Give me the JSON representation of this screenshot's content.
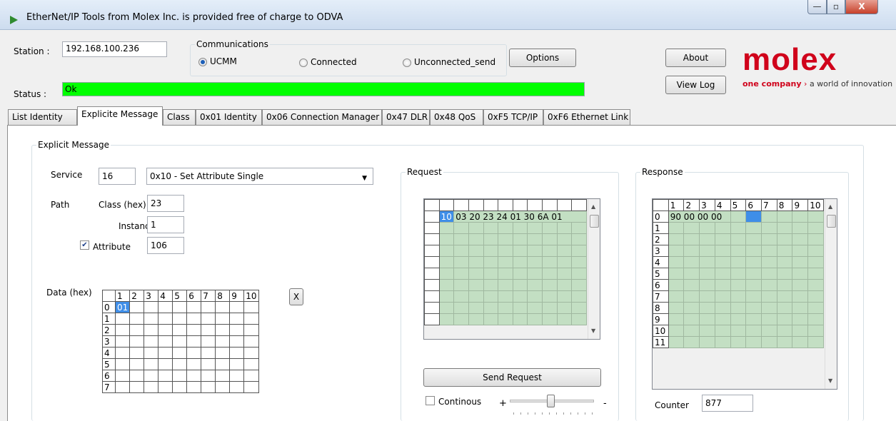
{
  "window": {
    "title": "EtherNet/IP Tools from Molex Inc. is provided free of charge to ODVA"
  },
  "caption_buttons": {
    "minimize": "—",
    "maximize": "▫",
    "close": "X"
  },
  "station": {
    "label": "Station :",
    "value": "192.168.100.236"
  },
  "communications": {
    "legend": "Communications",
    "options": [
      "UCMM",
      "Connected",
      "Unconnected_send"
    ],
    "selected": "UCMM"
  },
  "buttons": {
    "options": "Options",
    "about": "About",
    "view_log": "View Log",
    "send_request": "Send Request",
    "clear": "X"
  },
  "status": {
    "label": "Status :",
    "value": "Ok",
    "color": "#00ff00"
  },
  "logo": {
    "text": "molex",
    "tagline_bold": "one company",
    "tagline_rest": "a world of innovation",
    "color": "#d0021b"
  },
  "tabs": [
    "List Identity",
    "Explicite Message",
    "Class",
    "0x01 Identity",
    "0x06 Connection Manager",
    "0x47 DLR",
    "0x48 QoS",
    "0xF5 TCP/IP",
    "0xF6 Ethernet Link"
  ],
  "active_tab": "Explicite Message",
  "explicit": {
    "legend": "Explicit Message",
    "service_label": "Service",
    "service_code": "16",
    "service_selected": "0x10 - Set Attribute Single",
    "path_label": "Path",
    "class_label": "Class (hex)",
    "class_value": "23",
    "instance_label": "Instance",
    "instance_value": "1",
    "attribute_label": "Attribute",
    "attribute_checked": true,
    "attribute_value": "106",
    "data_label": "Data (hex)",
    "data_columns": [
      "1",
      "2",
      "3",
      "4",
      "5",
      "6",
      "7",
      "8",
      "9",
      "10"
    ],
    "data_rows": [
      "0",
      "1",
      "2",
      "3",
      "4",
      "5",
      "6",
      "7"
    ],
    "data_first_cell": "01"
  },
  "request": {
    "legend": "Request",
    "first_cell": "10",
    "row_text": "03 20 23 24 01 30 6A 01",
    "continous_label": "Continous",
    "slider_plus": "+",
    "slider_minus": "-"
  },
  "response": {
    "legend": "Response",
    "columns": [
      "1",
      "2",
      "3",
      "4",
      "5",
      "6",
      "7",
      "8",
      "9",
      "10"
    ],
    "rows": [
      "0",
      "1",
      "2",
      "3",
      "4",
      "5",
      "6",
      "7",
      "8",
      "9",
      "10",
      "11"
    ],
    "row0_text": "90 00 00 00",
    "counter_label": "Counter",
    "counter_value": "877"
  }
}
